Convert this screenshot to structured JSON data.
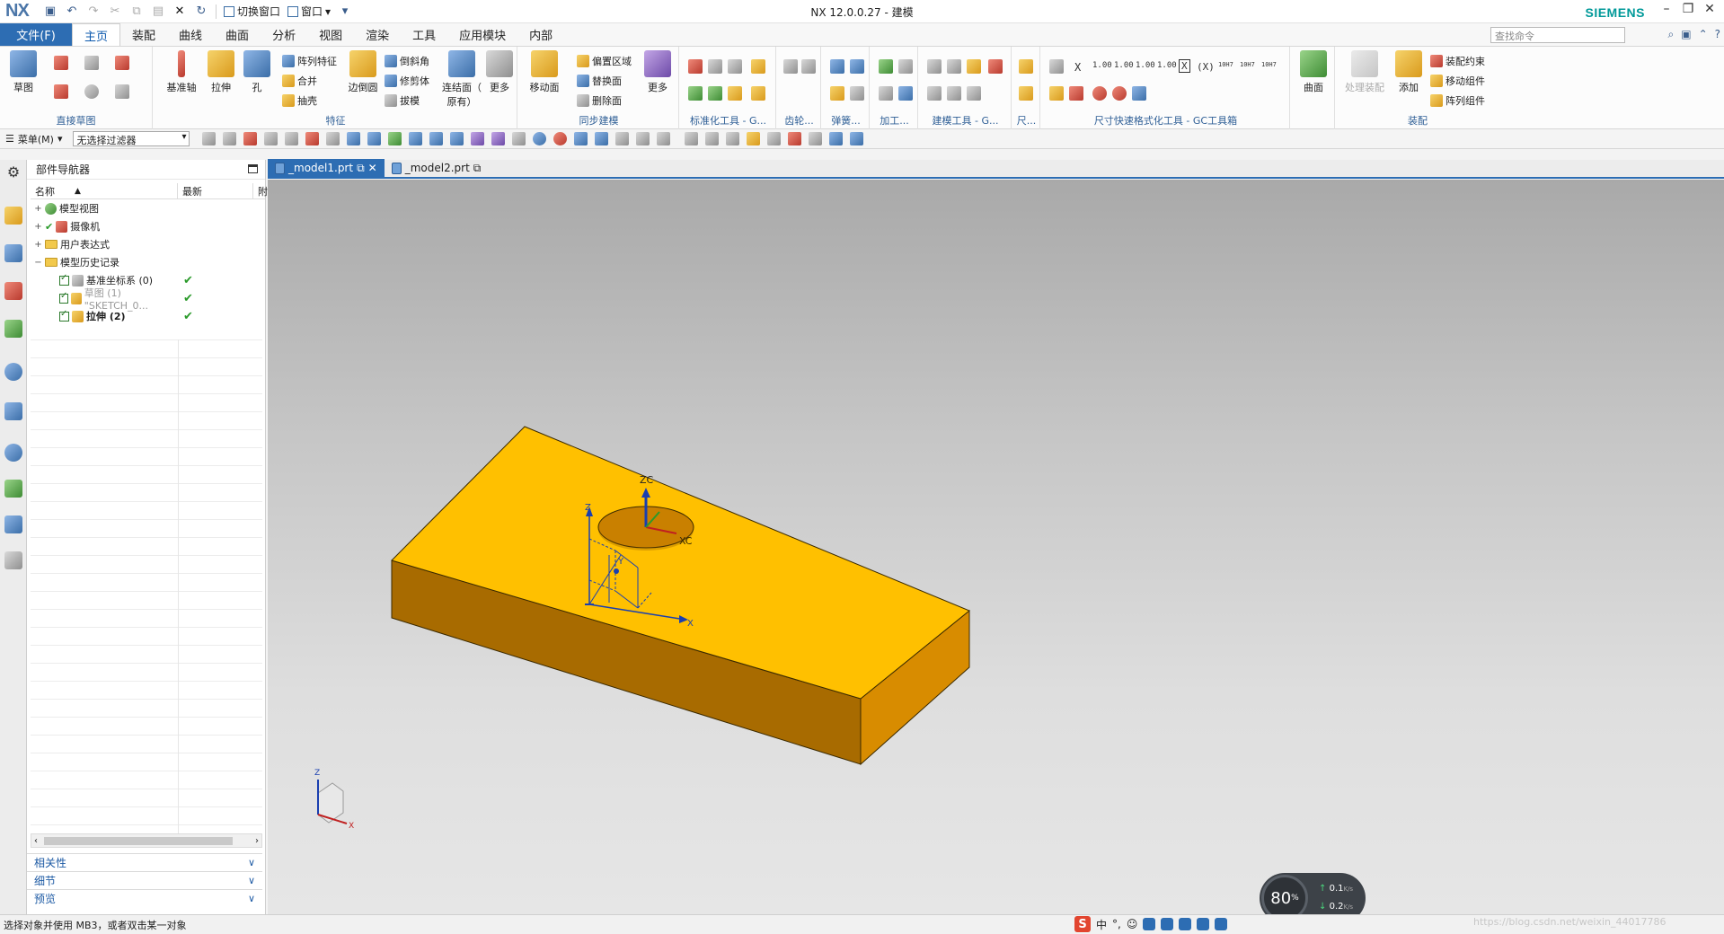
{
  "titlebar": {
    "logo": "NX",
    "title": "NX 12.0.0.27 - 建模",
    "switch_window": "切换窗口",
    "window_menu": "窗口",
    "brand": "SIEMENS",
    "controls": [
      "–",
      "❐",
      "✕"
    ]
  },
  "menu": {
    "file": "文件(F)",
    "tabs": [
      "主页",
      "装配",
      "曲线",
      "曲面",
      "分析",
      "视图",
      "渲染",
      "工具",
      "应用模块",
      "内部"
    ],
    "active_tab": "主页",
    "search_placeholder": "查找命令"
  },
  "ribbon": {
    "groups": [
      {
        "label": "直接草图"
      },
      {
        "label": "特征"
      },
      {
        "label": "同步建模"
      },
      {
        "label": "标准化工具 - G..."
      },
      {
        "label": "齿轮..."
      },
      {
        "label": "弹簧..."
      },
      {
        "label": "加工..."
      },
      {
        "label": "建模工具 - G..."
      },
      {
        "label": "尺..."
      },
      {
        "label": "尺寸快速格式化工具 - GC工具箱"
      },
      {
        "label": ""
      },
      {
        "label": "装配"
      }
    ],
    "sketch": {
      "sketch_label": "草图"
    },
    "feature": {
      "datum_axis": "基准轴",
      "extrude": "拉伸",
      "hole": "孔",
      "pattern": "阵列特征",
      "unite": "合并",
      "shell": "抽壳",
      "edge_blend": "边倒圆",
      "chamfer": "倒斜角",
      "trim_body": "修剪体",
      "draft": "拔模",
      "offset_face_line1": "连结面（",
      "offset_face_line2": "原有）",
      "more": "更多"
    },
    "sync": {
      "move_face": "移动面",
      "offset_region": "偏置区域",
      "replace_face": "替换面",
      "delete_face": "删除面",
      "more": "更多"
    },
    "dim_labels": [
      "X",
      "1.00",
      "1.00",
      "1.00",
      "1.00",
      "X",
      "(X)",
      "10H7",
      "10H7",
      "10H7"
    ],
    "surface": {
      "label": "曲面"
    },
    "assembly": {
      "process_assembly": "处理装配",
      "add": "添加",
      "constraints": "装配约束",
      "move_component": "移动组件",
      "pattern_component": "阵列组件"
    }
  },
  "toolbar2": {
    "menu_label": "菜单(M)",
    "filter_value": "无选择过滤器"
  },
  "navigator": {
    "title": "部件导航器",
    "col_name": "名称",
    "col_latest": "最新",
    "col_extra": "附",
    "rows": [
      {
        "label": "模型视图",
        "latest": ""
      },
      {
        "label": "摄像机",
        "latest": ""
      },
      {
        "label": "用户表达式",
        "latest": ""
      },
      {
        "label": "模型历史记录",
        "latest": ""
      },
      {
        "label": "基准坐标系 (0)",
        "latest": "✔"
      },
      {
        "label": "草图 (1) \"SKETCH_0...",
        "latest": "✔"
      },
      {
        "label": "拉伸 (2)",
        "latest": "✔"
      }
    ],
    "panels": [
      "相关性",
      "细节",
      "预览"
    ]
  },
  "doc_tabs": [
    {
      "label": "_model1.prt"
    },
    {
      "label": "_model2.prt"
    }
  ],
  "viewport": {
    "labels": {
      "zc": "ZC",
      "xc": "XC",
      "z": "Z",
      "y": "Y",
      "x": "X",
      "tri_z": "Z",
      "tri_x": "X"
    },
    "colors": {
      "top": "#ffc000",
      "front": "#a86b00",
      "side": "#d88c00",
      "hole": "#c98000"
    }
  },
  "speed": {
    "percent": "80",
    "unit": "%",
    "up": "0.1",
    "down": "0.2",
    "rate_unit": "K/s"
  },
  "statusbar": {
    "message": "选择对象并使用 MB3，或者双击某一对象",
    "ime_s": "S",
    "ime_lang": "中",
    "watermark": "https://blog.csdn.net/weixin_44017786"
  }
}
